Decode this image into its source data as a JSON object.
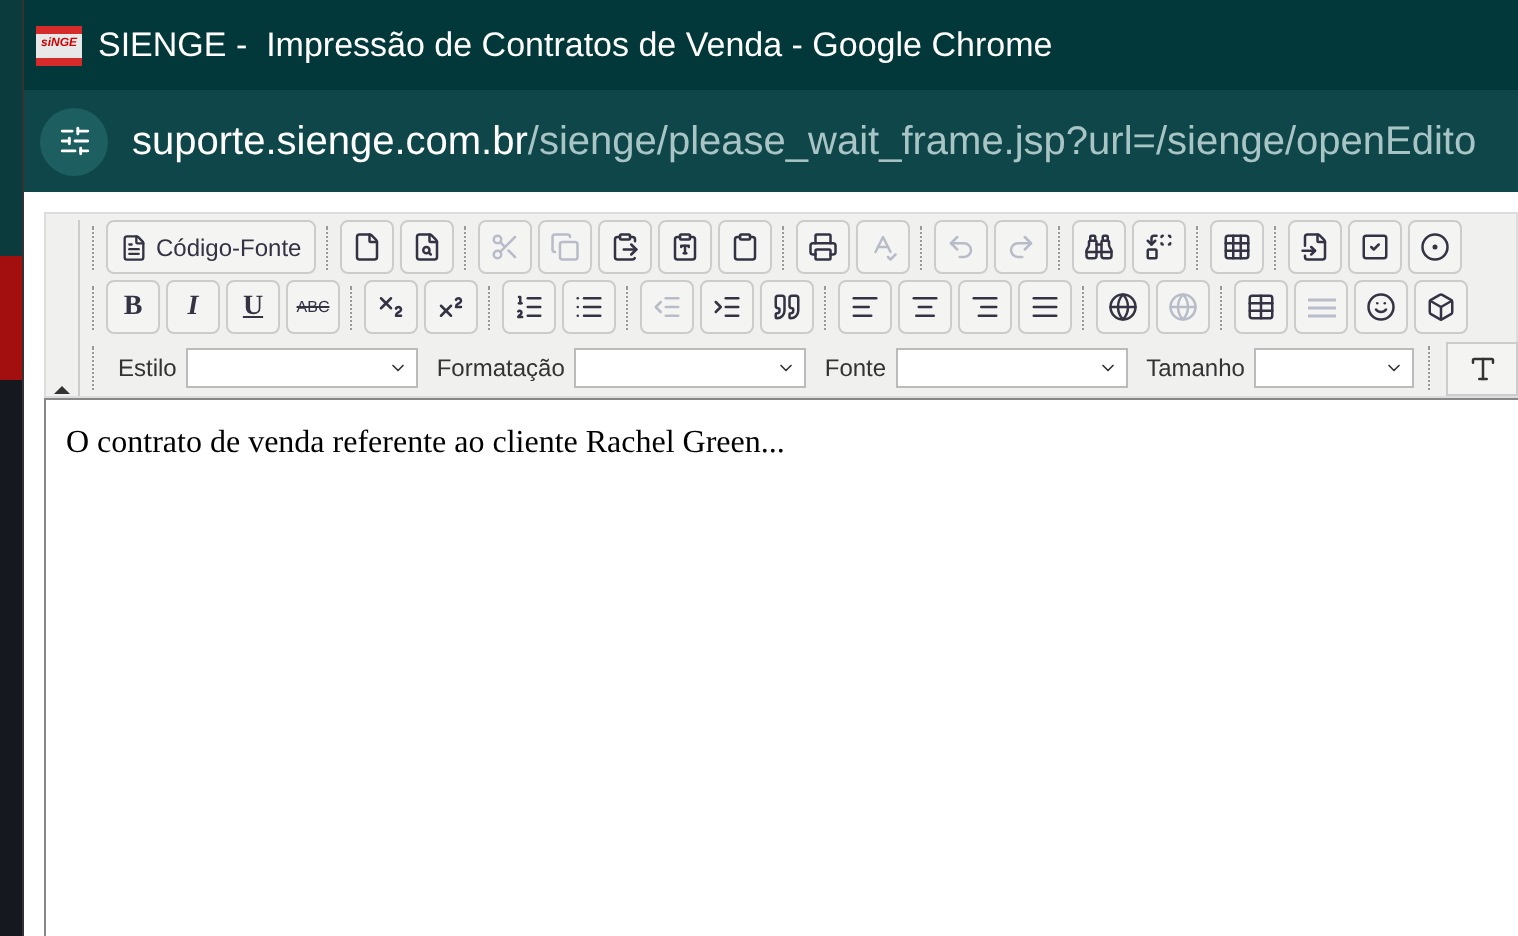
{
  "window": {
    "title": "SIENGE -  Impressão de Contratos de Venda - Google Chrome",
    "logo_text": "siNGE"
  },
  "address_bar": {
    "host": "suporte.sienge.com.br",
    "path": "/sienge/please_wait_frame.jsp?url=/sienge/openEdito"
  },
  "toolbar_rows": [
    [
      {
        "kind": "source",
        "label": "Código-Fonte",
        "disabled": false
      },
      {
        "kind": "sep"
      },
      {
        "kind": "new-page",
        "disabled": false
      },
      {
        "kind": "preview",
        "disabled": false
      },
      {
        "kind": "sep"
      },
      {
        "kind": "cut",
        "disabled": true
      },
      {
        "kind": "copy",
        "disabled": true
      },
      {
        "kind": "paste",
        "disabled": false
      },
      {
        "kind": "paste-text",
        "disabled": false
      },
      {
        "kind": "paste-word",
        "disabled": false
      },
      {
        "kind": "sep"
      },
      {
        "kind": "print",
        "disabled": false
      },
      {
        "kind": "spell",
        "disabled": true
      },
      {
        "kind": "sep"
      },
      {
        "kind": "undo",
        "disabled": true
      },
      {
        "kind": "redo",
        "disabled": true
      },
      {
        "kind": "sep"
      },
      {
        "kind": "find",
        "disabled": false
      },
      {
        "kind": "replace",
        "disabled": false
      },
      {
        "kind": "sep"
      },
      {
        "kind": "select-all",
        "disabled": false
      },
      {
        "kind": "sep"
      },
      {
        "kind": "form",
        "disabled": false
      },
      {
        "kind": "checkbox",
        "disabled": false
      },
      {
        "kind": "radio",
        "disabled": false
      }
    ],
    [
      {
        "kind": "bold",
        "label": "B",
        "disabled": false
      },
      {
        "kind": "italic",
        "label": "I",
        "disabled": false
      },
      {
        "kind": "underline",
        "label": "U",
        "disabled": false
      },
      {
        "kind": "strike",
        "label": "ABC",
        "disabled": false
      },
      {
        "kind": "sep"
      },
      {
        "kind": "subscript",
        "disabled": false
      },
      {
        "kind": "superscript",
        "disabled": false
      },
      {
        "kind": "sep"
      },
      {
        "kind": "ordered-list",
        "disabled": false
      },
      {
        "kind": "bullet-list",
        "disabled": false
      },
      {
        "kind": "sep"
      },
      {
        "kind": "outdent",
        "disabled": true
      },
      {
        "kind": "indent",
        "disabled": false
      },
      {
        "kind": "quote",
        "disabled": false
      },
      {
        "kind": "sep"
      },
      {
        "kind": "align-left",
        "disabled": false
      },
      {
        "kind": "align-center",
        "disabled": false
      },
      {
        "kind": "align-right",
        "disabled": false
      },
      {
        "kind": "justify",
        "disabled": false
      },
      {
        "kind": "sep"
      },
      {
        "kind": "link",
        "disabled": false
      },
      {
        "kind": "unlink",
        "disabled": true
      },
      {
        "kind": "sep"
      },
      {
        "kind": "table",
        "disabled": false
      },
      {
        "kind": "rule",
        "disabled": true
      },
      {
        "kind": "smiley",
        "disabled": false
      },
      {
        "kind": "special-char",
        "disabled": false
      }
    ]
  ],
  "format_row": [
    {
      "label": "Estilo"
    },
    {
      "label": "Formatação"
    },
    {
      "label": "Fonte"
    },
    {
      "label": "Tamanho"
    }
  ],
  "editor": {
    "text": "O contrato de venda referente ao cliente Rachel Green..."
  }
}
